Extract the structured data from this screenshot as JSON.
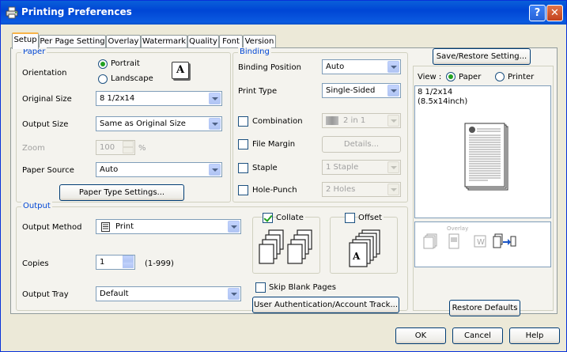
{
  "window": {
    "title": "Printing Preferences"
  },
  "tabs": [
    {
      "label": "Setup"
    },
    {
      "label": "Per Page Setting"
    },
    {
      "label": "Overlay"
    },
    {
      "label": "Watermark"
    },
    {
      "label": "Quality"
    },
    {
      "label": "Font"
    },
    {
      "label": "Version"
    }
  ],
  "paper": {
    "group_title": "Paper",
    "orientation_label": "Orientation",
    "portrait_label": "Portrait",
    "landscape_label": "Landscape",
    "orientation_selected": "Portrait",
    "orientation_icon_letter": "A",
    "original_size_label": "Original Size",
    "original_size_value": "8 1/2x14",
    "output_size_label": "Output Size",
    "output_size_value": "Same as Original Size",
    "zoom_label": "Zoom",
    "zoom_value": "100",
    "zoom_unit": "%",
    "paper_source_label": "Paper Source",
    "paper_source_value": "Auto",
    "paper_type_button": "Paper Type Settings..."
  },
  "binding": {
    "group_title": "Binding",
    "binding_position_label": "Binding Position",
    "binding_position_value": "Auto",
    "print_type_label": "Print Type",
    "print_type_value": "Single-Sided",
    "combination_label": "Combination",
    "combination_value": "2 in 1",
    "file_margin_label": "File Margin",
    "details_button": "Details...",
    "staple_label": "Staple",
    "staple_value": "1 Staple",
    "hole_punch_label": "Hole-Punch",
    "hole_punch_value": "2 Holes"
  },
  "output": {
    "group_title": "Output",
    "output_method_label": "Output Method",
    "output_method_value": "Print",
    "copies_label": "Copies",
    "copies_value": "1",
    "copies_range": "(1-999)",
    "output_tray_label": "Output Tray",
    "output_tray_value": "Default",
    "collate_label": "Collate",
    "collate_checked": true,
    "offset_label": "Offset",
    "offset_checked": false,
    "offset_icon_letter": "A",
    "skip_blank_label": "Skip Blank Pages",
    "user_auth_button": "User Authentication/Account Track..."
  },
  "preview": {
    "save_restore_button": "Save/Restore Setting...",
    "view_label": "View :",
    "view_paper_label": "Paper",
    "view_printer_label": "Printer",
    "view_selected": "Paper",
    "paper_size_line1": "8 1/2x14",
    "paper_size_line2": "(8.5x14inch)",
    "overlay_icon_label": "Overlay",
    "restore_defaults_button": "Restore Defaults"
  },
  "footer": {
    "ok": "OK",
    "cancel": "Cancel",
    "help": "Help"
  },
  "colors": {
    "title_bar": "#0046d5",
    "group_title": "#0046d5",
    "check_green": "#21a121"
  }
}
